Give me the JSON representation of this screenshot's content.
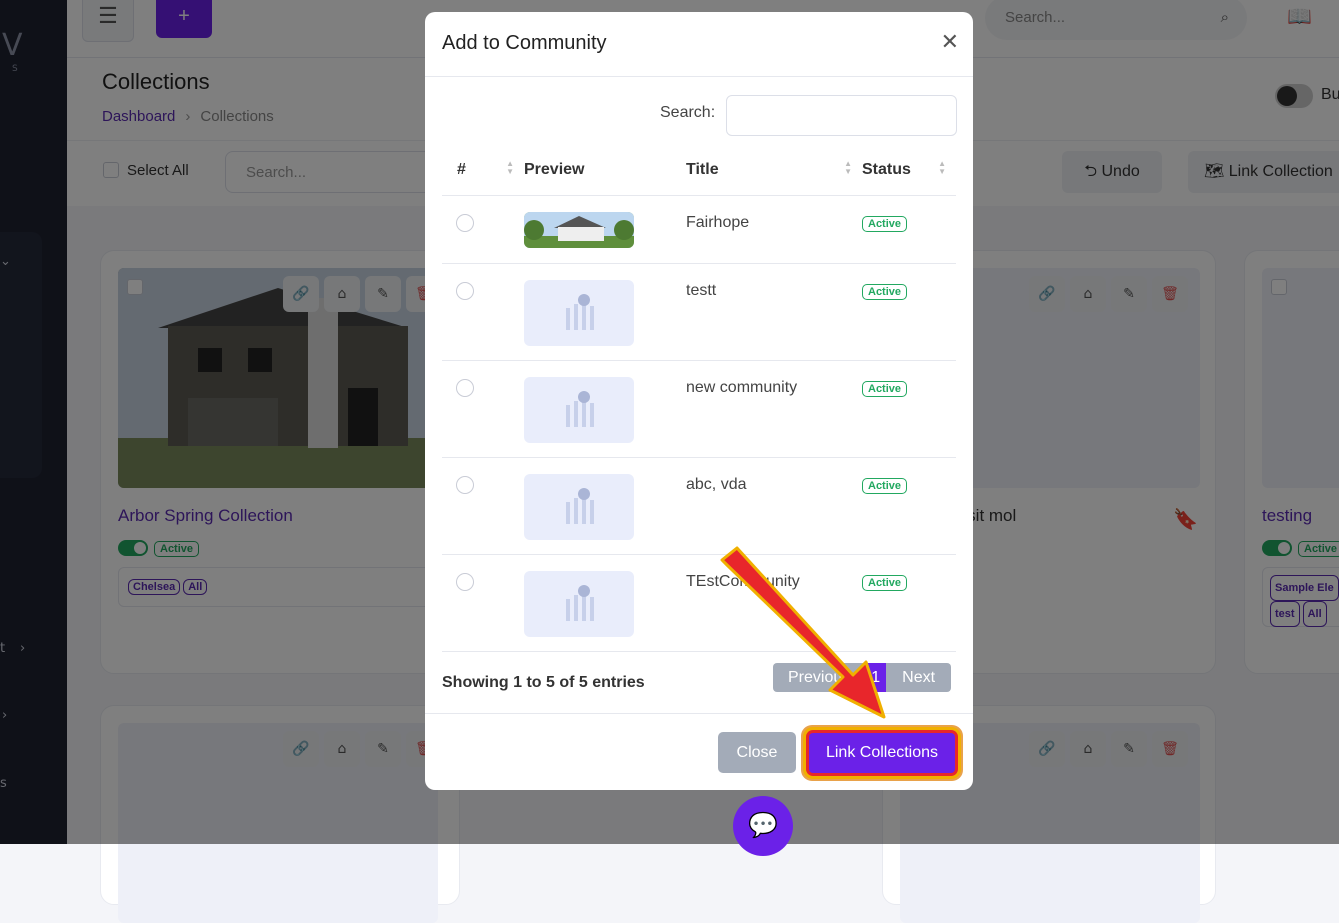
{
  "sidebar": {
    "logo": "V",
    "logo_sub": "S",
    "chevrons": [
      "⌄",
      "›",
      "›"
    ],
    "letters": [
      "t",
      "s"
    ]
  },
  "topbar": {
    "menu_icon": "☰",
    "add_label": "+",
    "search_placeholder": "Search...",
    "search_icon": "⌕",
    "book_icon": "📖"
  },
  "header": {
    "title": "Collections",
    "breadcrumb": [
      "Dashboard",
      "Collections"
    ],
    "toggle_label": "Bu"
  },
  "toolbar": {
    "select_all": "Select All",
    "search_placeholder": "Search...",
    "undo": "⮌ Undo",
    "link_collection": "🗺 Link Collection"
  },
  "cards": [
    {
      "title": "Arbor Spring Collection",
      "status": "Active",
      "tags": [
        "Chelsea",
        "All"
      ]
    },
    {
      "title": "n sit mol"
    },
    {
      "title": "testing",
      "status": "Active",
      "tags": [
        "Sample Ele",
        "test",
        "All"
      ]
    }
  ],
  "modal": {
    "title": "Add to Community",
    "search_label": "Search:",
    "columns": [
      "#",
      "Preview",
      "Title",
      "Status"
    ],
    "rows": [
      {
        "title": "Fairhope",
        "status": "Active"
      },
      {
        "title": "testt",
        "status": "Active"
      },
      {
        "title": "new community",
        "status": "Active"
      },
      {
        "title": "abc, vda",
        "status": "Active"
      },
      {
        "title": "TEstCommunity",
        "status": "Active"
      }
    ],
    "showing": "Showing 1 to 5 of 5 entries",
    "pager": {
      "prev": "Previous",
      "current": "1",
      "next": "Next"
    },
    "close": "Close",
    "link": "Link Collections"
  },
  "colors": {
    "accent": "#6b21e8",
    "active": "#22a860",
    "arrow": "#e8262b"
  }
}
